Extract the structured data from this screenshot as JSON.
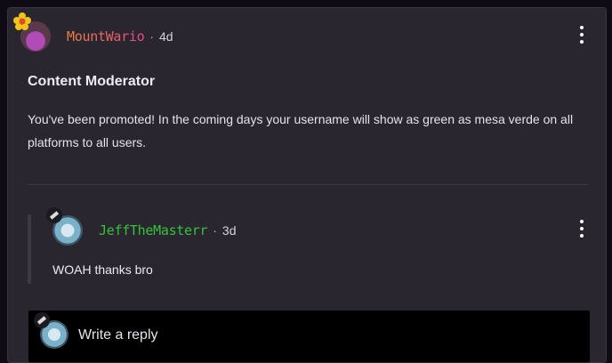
{
  "post": {
    "author": "MountWario",
    "separator": "·",
    "time": "4d",
    "title": "Content Moderator",
    "body": "You've been promoted!  In the coming days your username will show as green as mesa verde on all platforms to all users."
  },
  "reply": {
    "author": "JeffTheMasterr",
    "separator": "·",
    "time": "3d",
    "text": "WOAH thanks bro"
  },
  "composer": {
    "placeholder": "Write a reply"
  },
  "colors": {
    "card_bg": "#2a2630",
    "page_bg": "#0e0b14",
    "mount_username_gradient_start": "#f0823c",
    "mount_username_gradient_end": "#e84a8c",
    "jeff_username": "#35c23a"
  },
  "icons": {
    "post_menu": "kebab-menu-icon",
    "reply_menu": "kebab-menu-icon",
    "mount_badge": "flower-icon",
    "jeff_badge": "pencil-icon"
  }
}
